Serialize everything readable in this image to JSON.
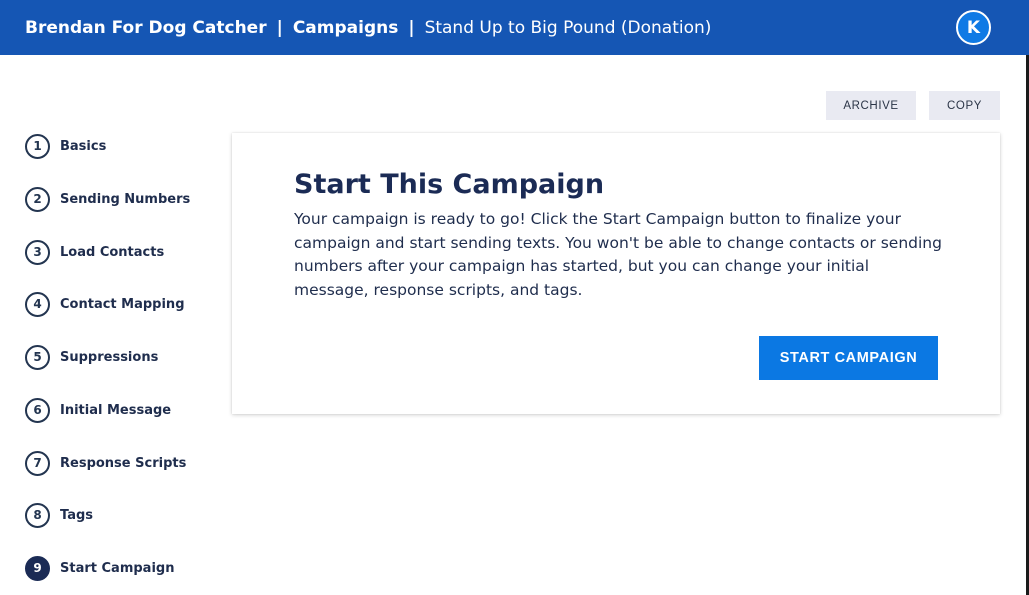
{
  "header": {
    "org": "Brendan For Dog Catcher",
    "separator": "|",
    "section": "Campaigns",
    "campaign": "Stand Up to Big Pound (Donation)",
    "avatar_letter": "K"
  },
  "actions": {
    "archive_label": "ARCHIVE",
    "copy_label": "COPY"
  },
  "steps": [
    {
      "num": "1",
      "label": "Basics"
    },
    {
      "num": "2",
      "label": "Sending Numbers"
    },
    {
      "num": "3",
      "label": "Load Contacts"
    },
    {
      "num": "4",
      "label": "Contact Mapping"
    },
    {
      "num": "5",
      "label": "Suppressions"
    },
    {
      "num": "6",
      "label": "Initial Message"
    },
    {
      "num": "7",
      "label": "Response Scripts"
    },
    {
      "num": "8",
      "label": "Tags"
    },
    {
      "num": "9",
      "label": "Start Campaign",
      "active": true
    }
  ],
  "card": {
    "title": "Start This Campaign",
    "body": "Your campaign is ready to go! Click the Start Campaign button to finalize your campaign and start sending texts. You won't be able to change contacts or sending numbers after your campaign has started, but you can change your initial message, response scripts, and tags.",
    "start_button_label": "START CAMPAIGN"
  },
  "colors": {
    "header_bg": "#1556b4",
    "primary": "#0b78e3",
    "navy": "#1b2b55"
  }
}
